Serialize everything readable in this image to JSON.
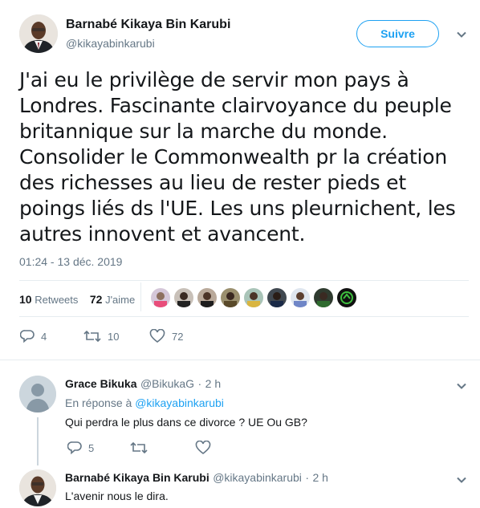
{
  "tweet": {
    "author_name": "Barnabé Kikaya Bin Karubi",
    "author_handle": "@kikayabinkarubi",
    "follow_label": "Suivre",
    "text": "J'ai eu le privilège de servir mon pays à Londres. Fascinante clairvoyance du peuple britannique sur la marche du monde. Consolider le Commonwealth pr la création des richesses au lieu de rester pieds et poings liés ds l'UE. Les uns pleurnichent, les autres innovent et avancent.",
    "timestamp": "01:24 - 13 déc. 2019",
    "retweets_count": "10",
    "retweets_label": "Retweets",
    "likes_count": "72",
    "likes_label": "J'aime",
    "reply_count": "4",
    "retweet_action_count": "10",
    "like_action_count": "72"
  },
  "replies": [
    {
      "author_name": "Grace Bikuka",
      "author_handle": "@BikukaG",
      "time": "2 h",
      "in_reply_prefix": "En réponse à",
      "in_reply_handle": "@kikayabinkarubi",
      "text": "Qui perdra le plus dans ce divorce ? UE Ou GB?",
      "reply_count": "5"
    },
    {
      "author_name": "Barnabé Kikaya Bin Karubi",
      "author_handle": "@kikayabinkarubi",
      "time": "2 h",
      "text": "L'avenir nous le dira."
    }
  ],
  "separator": "·",
  "colors": {
    "accent": "#1da1f2",
    "muted": "#657786",
    "text": "#14171a",
    "border": "#e6ecf0"
  },
  "icons": [
    "reply-icon",
    "retweet-icon",
    "like-icon",
    "chevron-down-icon",
    "default-avatar-icon"
  ]
}
